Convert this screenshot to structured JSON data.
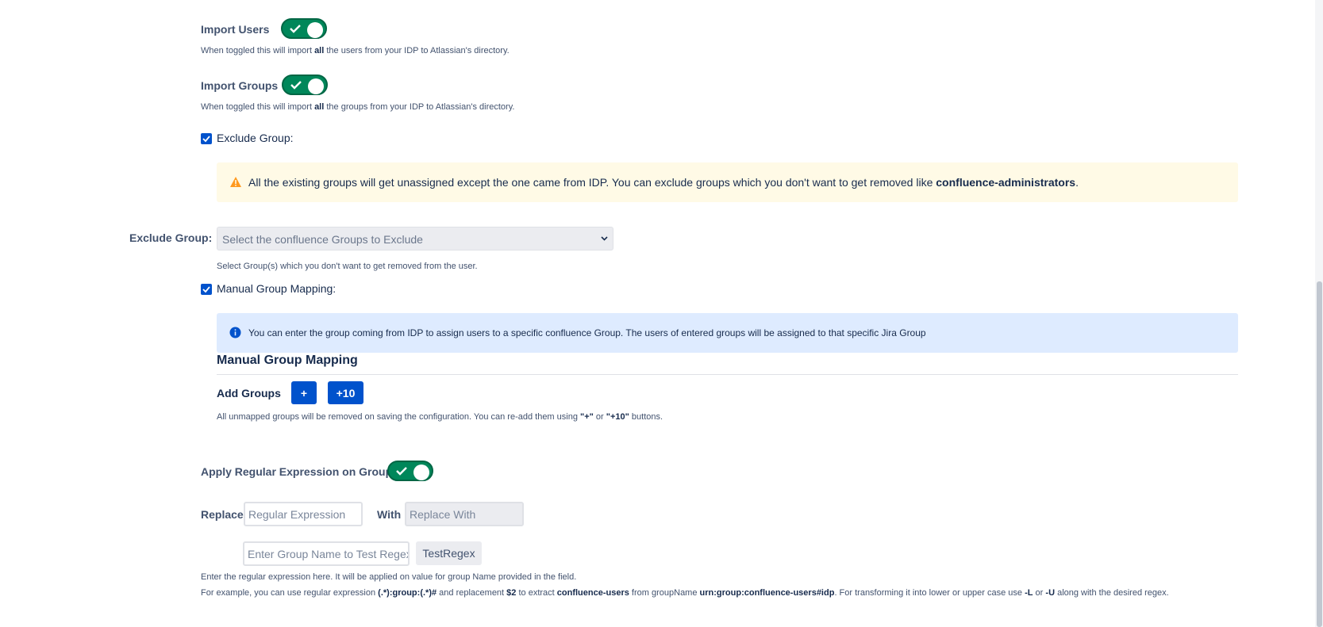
{
  "import_users": {
    "label": "Import Users",
    "help_pre": "When toggled this will import ",
    "help_bold": "all",
    "help_post": " the users from your IDP to Atlassian's directory."
  },
  "import_groups": {
    "label": "Import Groups",
    "help_pre": "When toggled this will import ",
    "help_bold": "all",
    "help_post": " the groups from your IDP to Atlassian's directory."
  },
  "exclude_group_checkbox": {
    "label": "Exclude Group:"
  },
  "warning": {
    "text": "All the existing groups will get unassigned except the one came from IDP. You can exclude groups which you don't want to get removed like ",
    "bold": "confluence-administrators",
    "end": "."
  },
  "exclude_select": {
    "label": "Exclude Group:",
    "placeholder": "Select the confluence Groups to Exclude",
    "help": "Select Group(s) which you don't want to get removed from the user."
  },
  "manual_mapping_checkbox": {
    "label": "Manual Group Mapping:"
  },
  "info": {
    "text": "You can enter the group coming from IDP to assign users to a specific confluence Group. The users of entered groups will be assigned to that specific Jira Group"
  },
  "manual_mapping": {
    "heading": "Manual Group Mapping",
    "add_groups_label": "Add Groups",
    "add_one": "+",
    "add_ten": "+10",
    "help_pre": "All unmapped groups will be removed on saving the configuration. You can re-add them using ",
    "help_b1": "\"+\"",
    "help_mid": " or ",
    "help_b2": "\"+10\"",
    "help_post": " buttons."
  },
  "regex": {
    "label": "Apply Regular Expression on Groups",
    "replace_label": "Replace",
    "replace_placeholder": "Regular Expression",
    "with_label": "With",
    "with_placeholder": "Replace With",
    "test_placeholder": "Enter Group Name to Test Regex",
    "test_button": "TestRegex",
    "help1": "Enter the regular expression here. It will be applied on value for group Name provided in the field.",
    "help2_a": "For example, you can use regular expression ",
    "help2_b": "(.*):group:(.*)#",
    "help2_c": " and replacement ",
    "help2_d": "$2",
    "help2_e": " to extract ",
    "help2_f": "confluence-users",
    "help2_g": " from groupName ",
    "help2_h": "urn:group:confluence-users#idp",
    "help2_i": ". For transforming it into lower or upper case use ",
    "help2_j": "-L",
    "help2_k": " or ",
    "help2_l": "-U",
    "help2_m": " along with the desired regex."
  },
  "colors": {
    "toggle_on": "#00875a",
    "primary": "#0052cc",
    "warning_bg": "#fffae6",
    "info_bg": "#deebff"
  }
}
